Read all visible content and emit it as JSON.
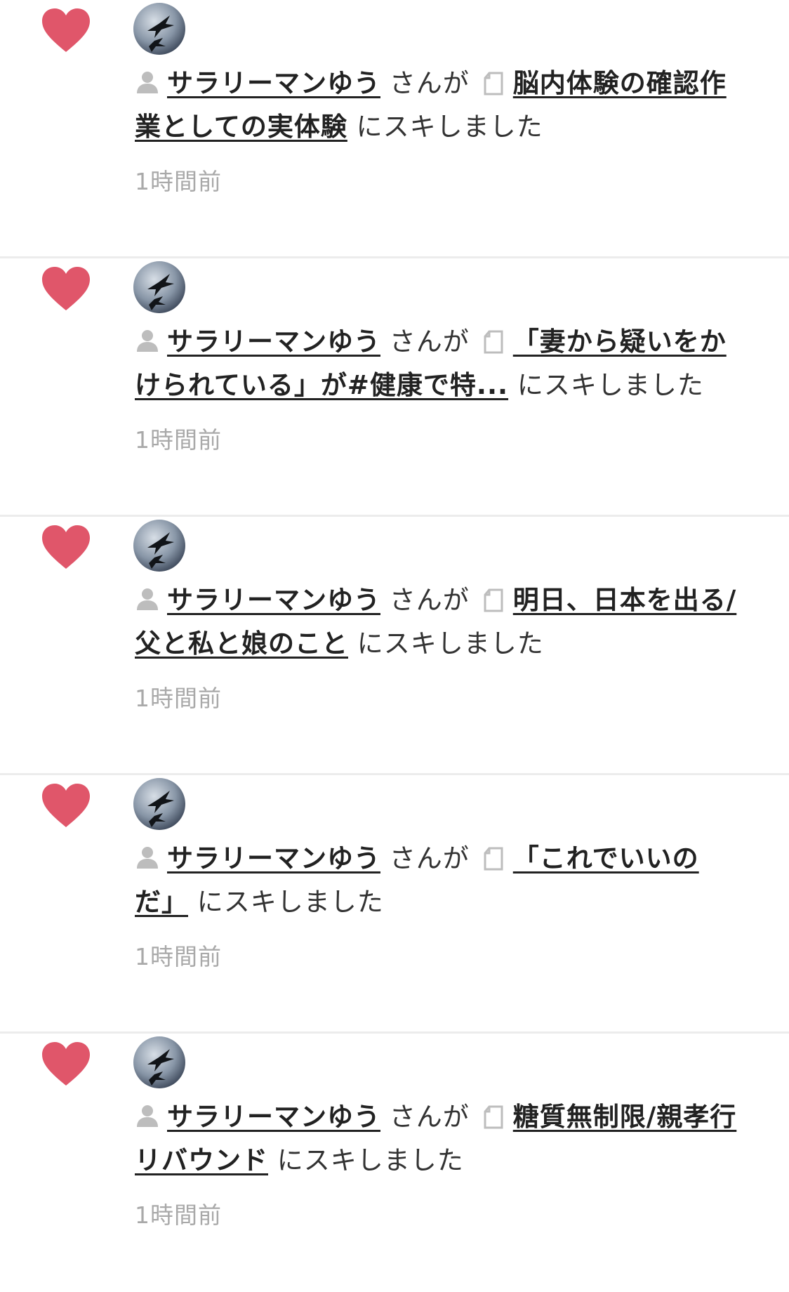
{
  "notifications": [
    {
      "user": "サラリーマンゆう",
      "connector": "さんが",
      "title": "脳内体験の確認作業としての実体験",
      "action": "にスキしました",
      "time": "1時間前"
    },
    {
      "user": "サラリーマンゆう",
      "connector": "さんが",
      "title": "「妻から疑いをかけられている」が#健康で特...",
      "action": "にスキしました",
      "time": "1時間前"
    },
    {
      "user": "サラリーマンゆう",
      "connector": "さんが",
      "title": "明日、日本を出る/父と私と娘のこと",
      "action": "にスキしました",
      "time": "1時間前"
    },
    {
      "user": "サラリーマンゆう",
      "connector": "さんが",
      "title": "「これでいいのだ」",
      "action": "にスキしました",
      "time": "1時間前"
    },
    {
      "user": "サラリーマンゆう",
      "connector": "さんが",
      "title": "糖質無制限/親孝行リバウンド",
      "action": "にスキしました",
      "time": "1時間前"
    }
  ],
  "colors": {
    "heart": "#e0566a",
    "time_text": "#a9a9a9",
    "divider": "#ececec",
    "icon_gray": "#bdbdbd"
  },
  "icons": {
    "like": "heart-icon",
    "user": "person-icon",
    "note": "note-icon"
  }
}
